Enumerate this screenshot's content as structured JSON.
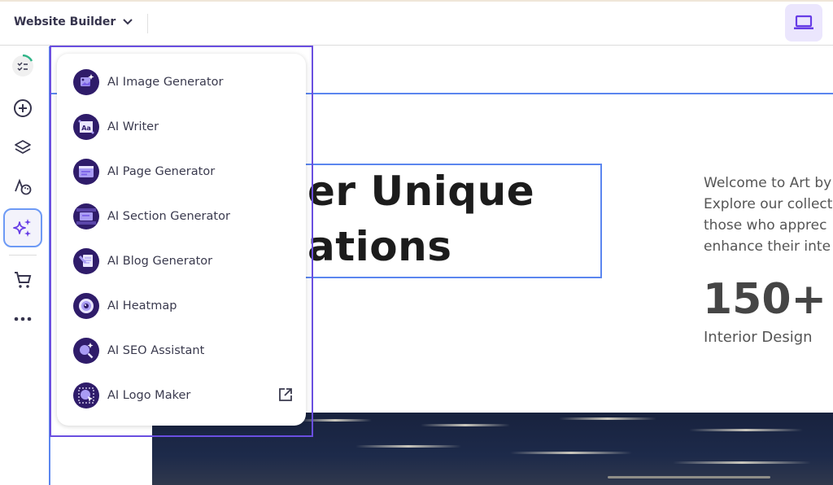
{
  "header": {
    "title": "Website Builder",
    "device_icon": "laptop-icon",
    "accent": "#673de6"
  },
  "sidebar": {
    "items": [
      {
        "name": "checklist",
        "icon": "checklist-progress-icon"
      },
      {
        "name": "add",
        "icon": "plus-circle-icon"
      },
      {
        "name": "layers",
        "icon": "layers-icon"
      },
      {
        "name": "styles",
        "icon": "typography-palette-icon"
      },
      {
        "name": "ai-tools",
        "icon": "sparkles-icon",
        "selected": true
      },
      {
        "name": "store",
        "icon": "cart-icon"
      },
      {
        "name": "more",
        "icon": "more-icon"
      }
    ]
  },
  "menu": {
    "items": [
      {
        "label": "AI Image Generator",
        "icon": "ai-image-icon"
      },
      {
        "label": "AI Writer",
        "icon": "ai-writer-icon"
      },
      {
        "label": "AI Page Generator",
        "icon": "ai-page-icon"
      },
      {
        "label": "AI Section Generator",
        "icon": "ai-section-icon"
      },
      {
        "label": "AI Blog Generator",
        "icon": "ai-blog-icon"
      },
      {
        "label": "AI Heatmap",
        "icon": "ai-heatmap-icon"
      },
      {
        "label": "AI SEO Assistant",
        "icon": "ai-seo-icon"
      },
      {
        "label": "AI Logo Maker",
        "icon": "ai-logo-icon",
        "external": true
      }
    ]
  },
  "page": {
    "headline_line1": "er Unique",
    "headline_line2": "ations",
    "paragraph": [
      "Welcome to Art by",
      "Explore our collect",
      "those who apprec",
      "enhance their inte"
    ],
    "stat_value": "150+",
    "stat_label": "Interior Design"
  }
}
